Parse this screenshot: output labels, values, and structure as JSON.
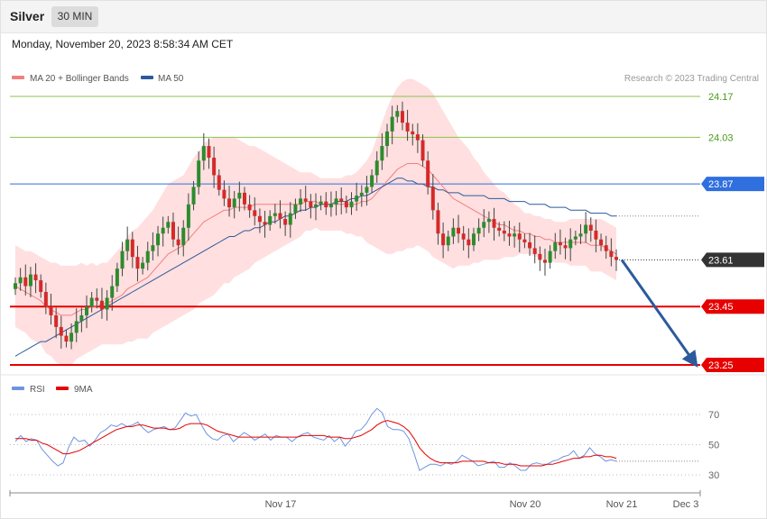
{
  "header": {
    "title": "Silver",
    "timeframe_label": "30 MIN"
  },
  "datetime": "Monday, November 20, 2023 8:58:34 AM CET",
  "copyright": "Research © 2023 Trading Central",
  "colors": {
    "ma20": "#f08080",
    "ma50": "#2c5a9c",
    "band_fill": "#ffd9d9",
    "candle_up": "#2e8b2e",
    "candle_down": "#d42a2a",
    "resistance": "#8bc34a",
    "pivot": "#2f6fde",
    "support": "#e60000",
    "last_price": "#333333",
    "arrow": "#2c5a9c",
    "rsi": "#6f94e0",
    "rsi_ma": "#e60000"
  },
  "chart_data": [
    {
      "type": "candlestick",
      "legend": [
        "MA 20 + Bollinger Bands",
        "MA 50"
      ],
      "ylim": [
        23.2,
        24.2
      ],
      "x_ticks": [
        "Nov 17",
        "Nov 20",
        "Nov 21",
        "Dec 3"
      ],
      "price_levels": [
        {
          "label": "24.17",
          "value": 24.17,
          "kind": "resistance"
        },
        {
          "label": "24.03",
          "value": 24.03,
          "kind": "resistance"
        },
        {
          "label": "23.87",
          "value": 23.87,
          "kind": "pivot"
        },
        {
          "label": "23.61",
          "value": 23.61,
          "kind": "last"
        },
        {
          "label": "23.45",
          "value": 23.45,
          "kind": "support"
        },
        {
          "label": "23.25",
          "value": 23.25,
          "kind": "support"
        }
      ],
      "arrow": {
        "from": 23.61,
        "to": 23.25,
        "direction": "down"
      },
      "closes": [
        23.53,
        23.55,
        23.52,
        23.56,
        23.54,
        23.5,
        23.45,
        23.42,
        23.38,
        23.35,
        23.33,
        23.36,
        23.4,
        23.42,
        23.45,
        23.48,
        23.47,
        23.44,
        23.48,
        23.52,
        23.58,
        23.64,
        23.68,
        23.62,
        23.58,
        23.6,
        23.64,
        23.66,
        23.7,
        23.72,
        23.74,
        23.68,
        23.66,
        23.72,
        23.8,
        23.86,
        23.95,
        24.0,
        23.96,
        23.9,
        23.85,
        23.82,
        23.79,
        23.82,
        23.84,
        23.8,
        23.78,
        23.76,
        23.74,
        23.73,
        23.76,
        23.77,
        23.75,
        23.73,
        23.77,
        23.8,
        23.82,
        23.81,
        23.79,
        23.8,
        23.81,
        23.79,
        23.8,
        23.82,
        23.81,
        23.79,
        23.81,
        23.83,
        23.84,
        23.86,
        23.9,
        23.95,
        24.0,
        24.05,
        24.1,
        24.12,
        24.08,
        24.05,
        24.04,
        24.02,
        23.95,
        23.86,
        23.78,
        23.7,
        23.66,
        23.69,
        23.72,
        23.7,
        23.68,
        23.66,
        23.7,
        23.72,
        23.74,
        23.75,
        23.72,
        23.71,
        23.7,
        23.69,
        23.7,
        23.68,
        23.67,
        23.65,
        23.63,
        23.61,
        23.6,
        23.64,
        23.67,
        23.66,
        23.65,
        23.68,
        23.69,
        23.7,
        23.73,
        23.71,
        23.68,
        23.66,
        23.64,
        23.62,
        23.61
      ],
      "ma20": [
        23.52,
        23.51,
        23.5,
        23.49,
        23.48,
        23.47,
        23.45,
        23.44,
        23.43,
        23.42,
        23.42,
        23.42,
        23.43,
        23.44,
        23.44,
        23.45,
        23.45,
        23.46,
        23.46,
        23.47,
        23.48,
        23.49,
        23.51,
        23.52,
        23.53,
        23.54,
        23.55,
        23.57,
        23.59,
        23.61,
        23.63,
        23.64,
        23.65,
        23.66,
        23.68,
        23.7,
        23.72,
        23.74,
        23.75,
        23.76,
        23.77,
        23.78,
        23.78,
        23.79,
        23.79,
        23.79,
        23.79,
        23.8,
        23.8,
        23.8,
        23.8,
        23.8,
        23.8,
        23.8,
        23.8,
        23.8,
        23.8,
        23.81,
        23.81,
        23.81,
        23.8,
        23.8,
        23.8,
        23.8,
        23.8,
        23.8,
        23.8,
        23.8,
        23.81,
        23.81,
        23.82,
        23.84,
        23.86,
        23.88,
        23.9,
        23.92,
        23.93,
        23.94,
        23.94,
        23.94,
        23.93,
        23.92,
        23.9,
        23.88,
        23.86,
        23.84,
        23.82,
        23.81,
        23.8,
        23.79,
        23.78,
        23.77,
        23.76,
        23.75,
        23.74,
        23.73,
        23.73,
        23.72,
        23.71,
        23.71,
        23.7,
        23.7,
        23.69,
        23.69,
        23.68,
        23.68,
        23.67,
        23.67,
        23.67,
        23.67,
        23.67,
        23.67,
        23.67,
        23.66,
        23.66,
        23.66,
        23.65,
        23.64,
        23.63
      ],
      "ma50": [
        23.28,
        23.29,
        23.3,
        23.31,
        23.32,
        23.33,
        23.33,
        23.34,
        23.35,
        23.36,
        23.37,
        23.38,
        23.39,
        23.4,
        23.41,
        23.42,
        23.43,
        23.44,
        23.45,
        23.46,
        23.47,
        23.48,
        23.49,
        23.5,
        23.51,
        23.52,
        23.53,
        23.54,
        23.55,
        23.56,
        23.57,
        23.58,
        23.59,
        23.6,
        23.61,
        23.62,
        23.63,
        23.64,
        23.65,
        23.66,
        23.67,
        23.68,
        23.69,
        23.69,
        23.7,
        23.71,
        23.71,
        23.72,
        23.72,
        23.73,
        23.74,
        23.74,
        23.75,
        23.76,
        23.76,
        23.77,
        23.78,
        23.78,
        23.79,
        23.79,
        23.8,
        23.8,
        23.8,
        23.81,
        23.81,
        23.81,
        23.82,
        23.82,
        23.83,
        23.83,
        23.84,
        23.85,
        23.86,
        23.87,
        23.88,
        23.89,
        23.89,
        23.88,
        23.88,
        23.87,
        23.87,
        23.86,
        23.86,
        23.85,
        23.85,
        23.84,
        23.84,
        23.84,
        23.83,
        23.83,
        23.83,
        23.83,
        23.83,
        23.82,
        23.82,
        23.82,
        23.82,
        23.81,
        23.81,
        23.81,
        23.81,
        23.8,
        23.8,
        23.8,
        23.8,
        23.79,
        23.79,
        23.79,
        23.79,
        23.78,
        23.78,
        23.78,
        23.78,
        23.77,
        23.77,
        23.77,
        23.77,
        23.76,
        23.76
      ],
      "band_width": [
        0.14,
        0.14,
        0.14,
        0.15,
        0.15,
        0.15,
        0.16,
        0.16,
        0.17,
        0.17,
        0.17,
        0.17,
        0.16,
        0.16,
        0.15,
        0.15,
        0.14,
        0.14,
        0.14,
        0.15,
        0.16,
        0.17,
        0.18,
        0.19,
        0.19,
        0.2,
        0.21,
        0.21,
        0.22,
        0.23,
        0.24,
        0.24,
        0.24,
        0.24,
        0.25,
        0.26,
        0.26,
        0.27,
        0.27,
        0.27,
        0.26,
        0.25,
        0.25,
        0.24,
        0.23,
        0.22,
        0.21,
        0.2,
        0.19,
        0.18,
        0.17,
        0.16,
        0.15,
        0.14,
        0.13,
        0.12,
        0.11,
        0.1,
        0.1,
        0.09,
        0.09,
        0.09,
        0.09,
        0.09,
        0.09,
        0.1,
        0.1,
        0.11,
        0.12,
        0.14,
        0.16,
        0.19,
        0.22,
        0.25,
        0.27,
        0.28,
        0.29,
        0.29,
        0.29,
        0.28,
        0.28,
        0.28,
        0.28,
        0.27,
        0.26,
        0.25,
        0.24,
        0.22,
        0.21,
        0.2,
        0.18,
        0.17,
        0.15,
        0.14,
        0.13,
        0.12,
        0.11,
        0.1,
        0.09,
        0.08,
        0.07,
        0.07,
        0.07,
        0.07,
        0.07,
        0.07,
        0.07,
        0.07,
        0.07,
        0.08,
        0.08,
        0.08,
        0.08,
        0.09,
        0.09,
        0.09,
        0.09,
        0.09,
        0.09
      ]
    },
    {
      "type": "line",
      "legend": [
        "RSI",
        "9MA"
      ],
      "ylim": [
        25,
        80
      ],
      "y_ticks": [
        70,
        50,
        30
      ],
      "series": [
        {
          "name": "RSI",
          "values": [
            52,
            56,
            52,
            54,
            53,
            47,
            43,
            39,
            36,
            38,
            48,
            55,
            52,
            53,
            49,
            53,
            58,
            60,
            63,
            62,
            64,
            62,
            63,
            65,
            61,
            58,
            60,
            61,
            62,
            60,
            61,
            66,
            71,
            69,
            70,
            63,
            57,
            54,
            53,
            56,
            57,
            52,
            55,
            58,
            56,
            53,
            55,
            57,
            53,
            56,
            55,
            55,
            52,
            55,
            57,
            58,
            55,
            54,
            53,
            56,
            52,
            55,
            49,
            53,
            59,
            60,
            64,
            70,
            74,
            71,
            62,
            60,
            60,
            59,
            54,
            44,
            33,
            35,
            37,
            37,
            36,
            38,
            37,
            39,
            43,
            41,
            39,
            36,
            37,
            38,
            39,
            35,
            35,
            38,
            36,
            33,
            33,
            37,
            38,
            37,
            37,
            39,
            40,
            42,
            43,
            46,
            41,
            43,
            48,
            44,
            42,
            39,
            40,
            39
          ]
        },
        {
          "name": "9MA",
          "values": [
            54,
            54,
            54,
            53,
            53,
            51,
            50,
            48,
            46,
            44,
            44,
            45,
            46,
            48,
            50,
            52,
            54,
            56,
            58,
            60,
            61,
            62,
            62,
            63,
            63,
            62,
            61,
            61,
            61,
            60,
            60,
            61,
            63,
            64,
            64,
            64,
            63,
            61,
            59,
            58,
            57,
            56,
            55,
            55,
            55,
            55,
            55,
            55,
            55,
            55,
            55,
            55,
            55,
            55,
            56,
            56,
            56,
            56,
            56,
            55,
            55,
            55,
            54,
            54,
            55,
            56,
            58,
            60,
            63,
            65,
            66,
            65,
            64,
            62,
            59,
            54,
            48,
            44,
            41,
            39,
            38,
            38,
            38,
            38,
            39,
            39,
            39,
            39,
            39,
            38,
            38,
            38,
            37,
            37,
            37,
            36,
            36,
            36,
            36,
            36,
            37,
            37,
            38,
            39,
            40,
            41,
            41,
            42,
            42,
            43,
            43,
            42,
            42,
            41
          ]
        }
      ]
    }
  ]
}
